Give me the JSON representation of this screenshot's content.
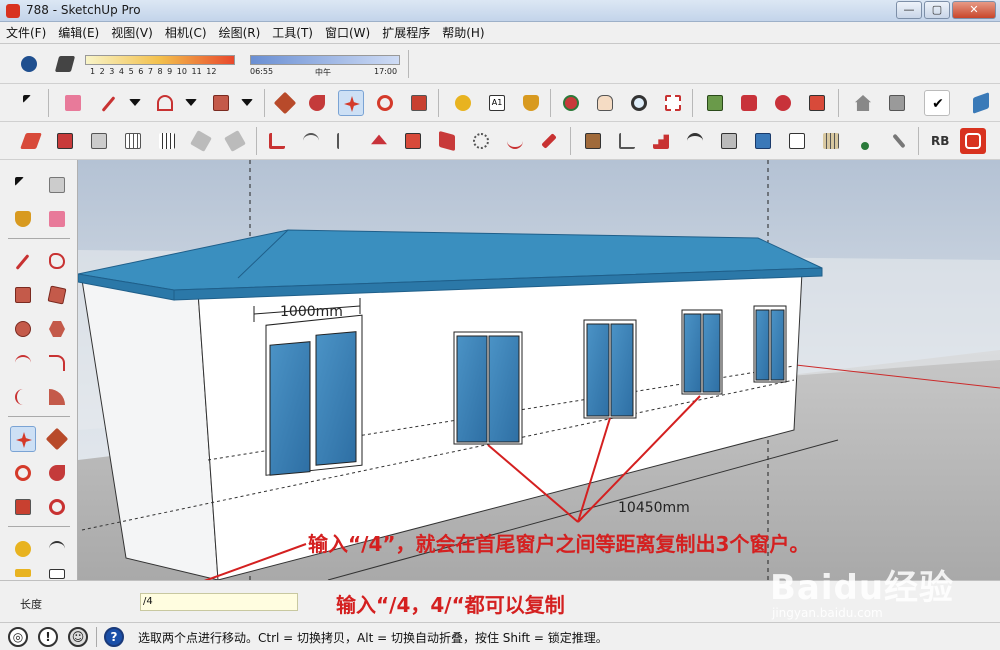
{
  "window": {
    "title": "788 - SketchUp Pro",
    "min_label": "—",
    "max_label": "▢",
    "close_label": "✕"
  },
  "menu": [
    "文件(F)",
    "编辑(E)",
    "视图(V)",
    "相机(C)",
    "绘图(R)",
    "工具(T)",
    "窗口(W)",
    "扩展程序",
    "帮助(H)"
  ],
  "shadows": {
    "months": [
      "1",
      "2",
      "3",
      "4",
      "5",
      "6",
      "7",
      "8",
      "9",
      "10",
      "11",
      "12"
    ],
    "time_start": "06:55",
    "time_mid": "中午",
    "time_end": "17:00"
  },
  "viewport": {
    "dimension_window": "1000mm",
    "dimension_wall": "10450mm",
    "annotation": "输入“/4”，就会在首尾窗户之间等距离复制出3个窗户。"
  },
  "vcb": {
    "label": "长度",
    "value": "/4",
    "note": "输入“/4，4/“都可以复制"
  },
  "status": {
    "text": "选取两个点进行移动。Ctrl = 切换拷贝，Alt = 切换自动折叠，按住 Shift = 锁定推理。"
  },
  "watermark": {
    "brand": "Baidu经验",
    "url": "jingyan.baidu.com"
  },
  "colors": {
    "accent_red": "#d42020",
    "roof": "#3a8fbf",
    "glass": "#4a95c8"
  }
}
